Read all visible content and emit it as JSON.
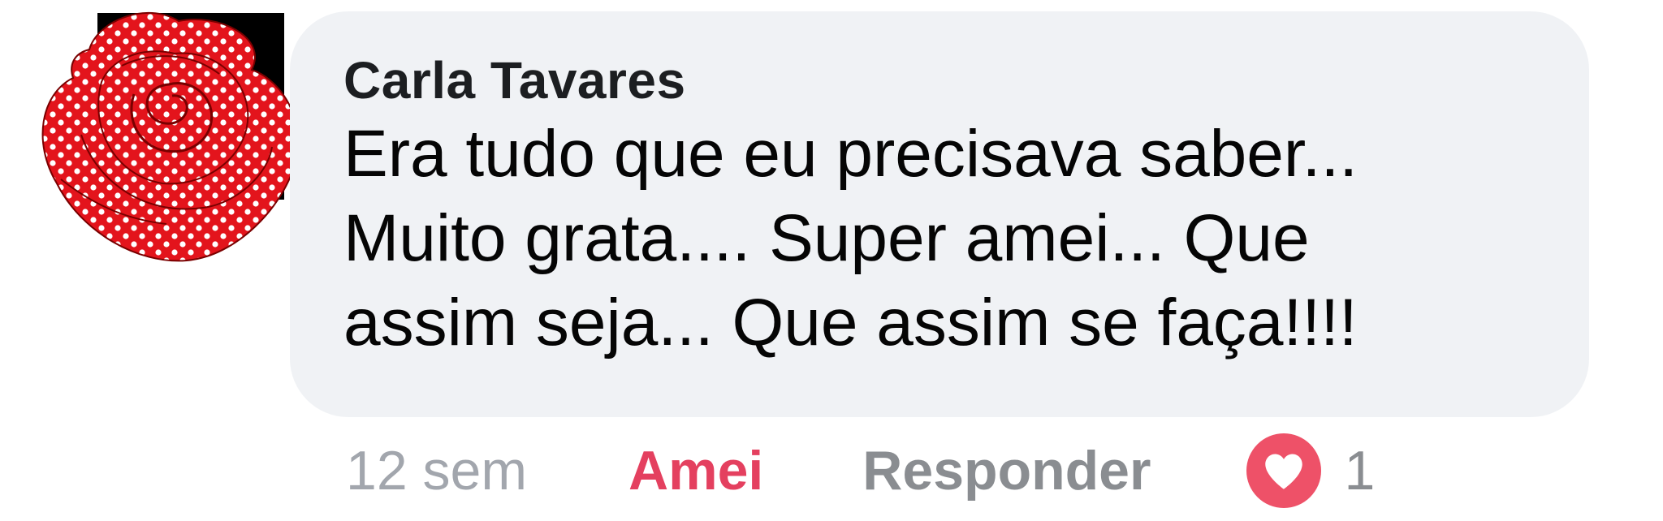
{
  "comment": {
    "author": "Carla Tavares",
    "lines": [
      "Era tudo que eu precisava saber...",
      "Muito grata.... Super amei... Que",
      "assim seja... Que assim se faça!!!!"
    ]
  },
  "actions": {
    "time": "12 sem",
    "reaction_label": "Amei",
    "reply_label": "Responder",
    "reaction_count": "1"
  },
  "icons": {
    "avatar": "red-polka-dot-rose-avatar",
    "reaction": "heart-icon"
  },
  "colors": {
    "bubble": "#f0f2f5",
    "love": "#e4405f",
    "muted": "#8a8d91",
    "heart_badge": "#ee5168"
  }
}
